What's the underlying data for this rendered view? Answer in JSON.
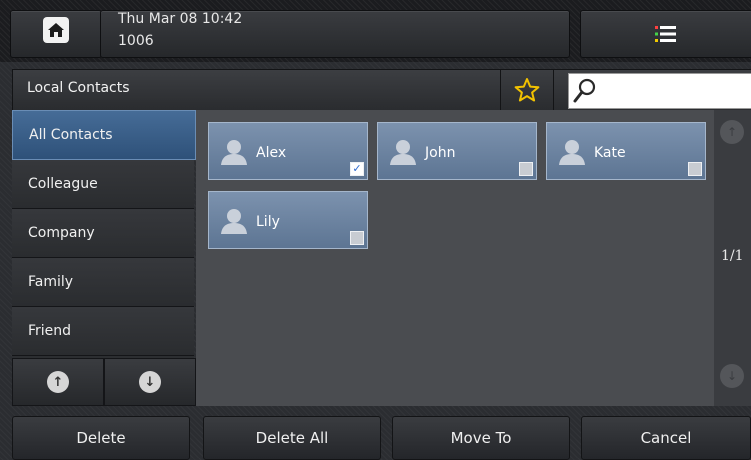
{
  "status": {
    "datetime": "Thu Mar 08 10:42",
    "extension": "1006"
  },
  "header": {
    "title": "Local Contacts",
    "search_placeholder": ""
  },
  "groups": [
    {
      "label": "All Contacts",
      "selected": true
    },
    {
      "label": "Colleague"
    },
    {
      "label": "Company"
    },
    {
      "label": "Family"
    },
    {
      "label": "Friend"
    }
  ],
  "contacts": [
    {
      "name": "Alex",
      "checked": true
    },
    {
      "name": "John",
      "checked": false
    },
    {
      "name": "Kate",
      "checked": false
    },
    {
      "name": "Lily",
      "checked": false
    }
  ],
  "pager": {
    "label": "1/1"
  },
  "actions": {
    "delete": "Delete",
    "delete_all": "Delete All",
    "move_to": "Move To",
    "cancel": "Cancel"
  },
  "icons": {
    "home": "home-icon",
    "menu": "menu-list-icon",
    "favorite": "star-icon",
    "search": "search-icon",
    "contact": "person-icon",
    "scroll_up": "arrow-up-icon",
    "scroll_down": "arrow-down-icon"
  },
  "colors": {
    "selected_group": "#3a5f8a",
    "contact_card": "#6e84a2",
    "star": "#f2c200",
    "check": "#2f6bd1"
  }
}
